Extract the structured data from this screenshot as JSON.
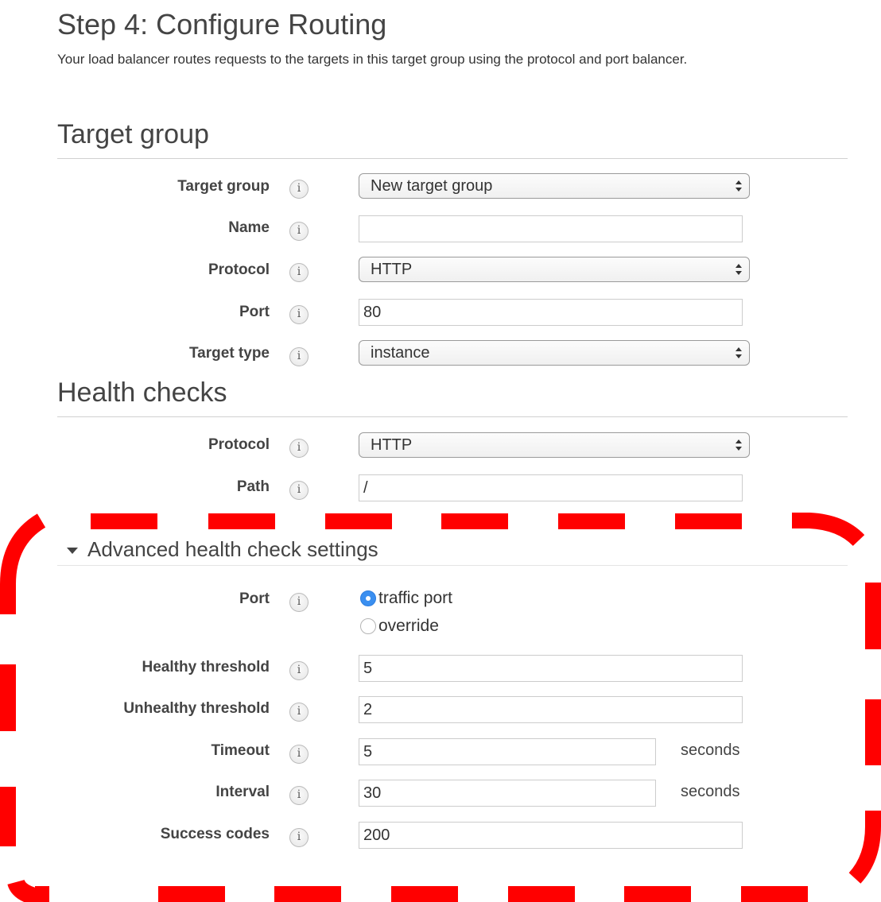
{
  "page": {
    "title": "Step 4: Configure Routing",
    "description": "Your load balancer routes requests to the targets in this target group using the protocol and port balancer."
  },
  "target_group_section": {
    "title": "Target group",
    "fields": {
      "target_group": {
        "label": "Target group",
        "type": "select",
        "value": "New target group"
      },
      "name": {
        "label": "Name",
        "type": "text",
        "value": ""
      },
      "protocol": {
        "label": "Protocol",
        "type": "select",
        "value": "HTTP"
      },
      "port": {
        "label": "Port",
        "type": "text",
        "value": "80"
      },
      "target_type": {
        "label": "Target type",
        "type": "select",
        "value": "instance"
      }
    }
  },
  "health_checks_section": {
    "title": "Health checks",
    "fields": {
      "protocol": {
        "label": "Protocol",
        "type": "select",
        "value": "HTTP"
      },
      "path": {
        "label": "Path",
        "type": "text",
        "value": "/"
      }
    }
  },
  "advanced_section": {
    "title": "Advanced health check settings",
    "expanded": true,
    "port": {
      "label": "Port",
      "options": [
        {
          "label": "traffic port",
          "selected": true
        },
        {
          "label": "override",
          "selected": false
        }
      ]
    },
    "fields": {
      "healthy_threshold": {
        "label": "Healthy threshold",
        "value": "5"
      },
      "unhealthy_threshold": {
        "label": "Unhealthy threshold",
        "value": "2"
      },
      "timeout": {
        "label": "Timeout",
        "value": "5",
        "unit": "seconds"
      },
      "interval": {
        "label": "Interval",
        "value": "30",
        "unit": "seconds"
      },
      "success_codes": {
        "label": "Success codes",
        "value": "200"
      }
    }
  },
  "icons": {
    "info": "i",
    "expand": "caret-down"
  },
  "colors": {
    "highlight": "#ff0000",
    "radio_selected": "#3a8ff0"
  }
}
